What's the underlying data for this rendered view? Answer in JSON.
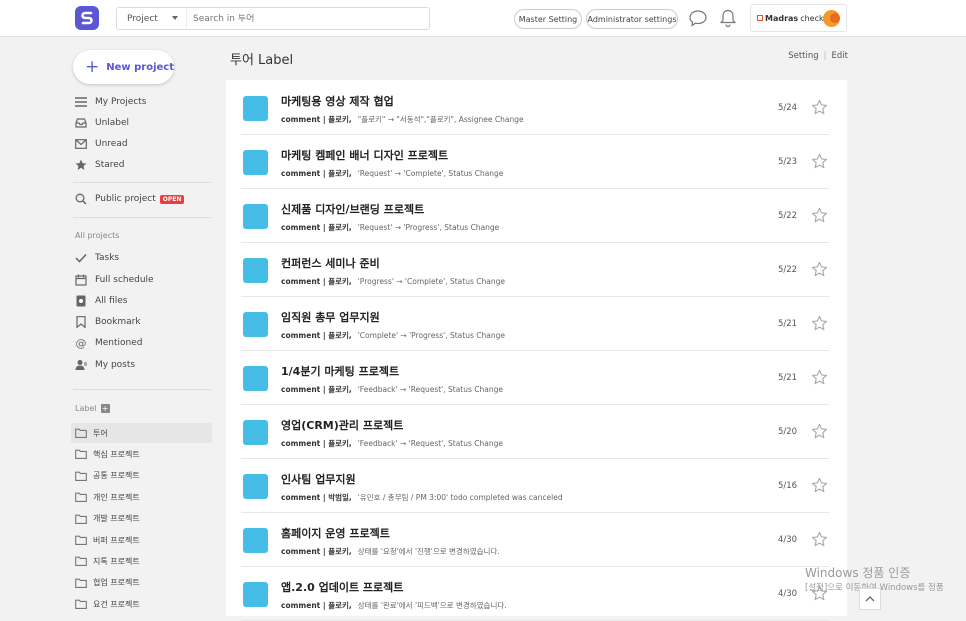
{
  "header": {
    "search_scope": "Project",
    "search_placeholder": "Search in 투어",
    "master_setting": "Master Setting",
    "admin_settings": "Administrator settings",
    "brand_name": "Madras",
    "brand_suffix": "check"
  },
  "sidebar": {
    "new_project": "New project",
    "primary": [
      {
        "label": "My Projects",
        "icon": "menu-lines-icon"
      },
      {
        "label": "Unlabel",
        "icon": "inbox-icon"
      },
      {
        "label": "Unread",
        "icon": "envelope-icon"
      },
      {
        "label": "Stared",
        "icon": "star-filled-icon"
      }
    ],
    "public_project": "Public project",
    "open_badge": "OPEN",
    "all_projects_title": "All projects",
    "all_projects": [
      {
        "label": "Tasks",
        "icon": "check-icon"
      },
      {
        "label": "Full schedule",
        "icon": "calendar-icon"
      },
      {
        "label": "All files",
        "icon": "file-icon"
      },
      {
        "label": "Bookmark",
        "icon": "bookmark-icon"
      },
      {
        "label": "Mentioned",
        "icon": "at-icon"
      },
      {
        "label": "My posts",
        "icon": "user-icon"
      }
    ],
    "label_title": "Label",
    "labels": [
      "투어",
      "핵심 프로젝트",
      "공통 프로젝트",
      "개인 프로젝트",
      "개발 프로젝트",
      "버퍼 프로젝트",
      "지톡 프로젝트",
      "협업 프로젝트",
      "요건 프로젝트"
    ]
  },
  "main": {
    "title": "투어 Label",
    "setting": "Setting",
    "edit": "Edit",
    "projects": [
      {
        "title": "마케팅용 영상 제작 협업",
        "who": "comment | 플로키,",
        "detail": "\"플로키\" → \"서동석\",\"플로키\", Assignee Change",
        "date": "5/24"
      },
      {
        "title": "마케팅 켐페인 배너 디자인 프로젝트",
        "who": "comment | 플로키,",
        "detail": "'Request' → 'Complete', Status Change",
        "date": "5/23"
      },
      {
        "title": "신제품 디자인/브랜딩 프로젝트",
        "who": "comment | 플로키,",
        "detail": "'Request' → 'Progress', Status Change",
        "date": "5/22"
      },
      {
        "title": "컨퍼런스 세미나 준비",
        "who": "comment | 플로키,",
        "detail": "'Progress' → 'Complete', Status Change",
        "date": "5/22"
      },
      {
        "title": "임직원 총무 업무지원",
        "who": "comment | 플로키,",
        "detail": "'Complete' → 'Progress', Status Change",
        "date": "5/21"
      },
      {
        "title": "1/4분기 마케팅 프로젝트",
        "who": "comment | 플로키,",
        "detail": "'Feedback' → 'Request', Status Change",
        "date": "5/21"
      },
      {
        "title": "영업(CRM)관리 프로젝트",
        "who": "comment | 플로키,",
        "detail": "'Feedback' → 'Request', Status Change",
        "date": "5/20"
      },
      {
        "title": "인사팀 업무지원",
        "who": "comment | 박범일,",
        "detail": "'유민호 / 총무팀 / PM 3:00' todo completed was canceled",
        "date": "5/16"
      },
      {
        "title": "홈페이지 운영 프로젝트",
        "who": "comment | 플로키,",
        "detail": "상태를 '요청'에서 '진행'으로 변경하였습니다.",
        "date": "4/30"
      },
      {
        "title": "앱.2.0 업데이트 프로젝트",
        "who": "comment | 플로키,",
        "detail": "상태를 '완료'에서 '피드백'으로 변경하였습니다.",
        "date": "4/30"
      }
    ]
  },
  "watermark": {
    "line1": "Windows 정품 인증",
    "line2": "[설정]으로 이동하여 Windows를 정품"
  }
}
